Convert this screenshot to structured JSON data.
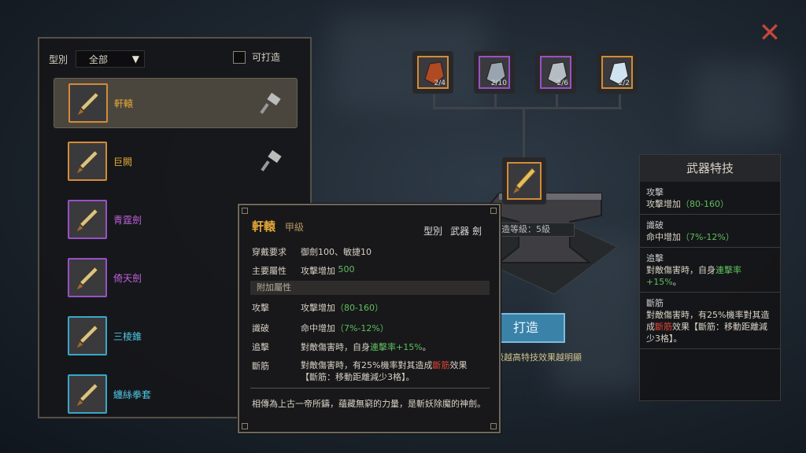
{
  "filter": {
    "label": "型別",
    "value": "全部",
    "checkbox_label": "可打造"
  },
  "items": [
    {
      "name": "軒轅",
      "color": "#e6a838",
      "border": "#d48c36",
      "hammer": true
    },
    {
      "name": "巨闕",
      "color": "#e6a838",
      "border": "#d48c36",
      "hammer": true
    },
    {
      "name": "青霆劍",
      "color": "#c060e0",
      "border": "#9a50c8",
      "hammer": false
    },
    {
      "name": "倚天劍",
      "color": "#c060e0",
      "border": "#9a50c8",
      "hammer": false
    },
    {
      "name": "三棱錐",
      "color": "#4ec7e8",
      "border": "#3aa6c8",
      "hammer": false
    },
    {
      "name": "纏絲拳套",
      "color": "#4ec7e8",
      "border": "#3aa6c8",
      "hammer": false
    }
  ],
  "tooltip": {
    "name": "軒轅",
    "grade": "甲級",
    "type_label": "型別",
    "type_value": "武器 劍",
    "req_label": "穿戴要求",
    "req_value": "御劍100、敏捷10",
    "main_label": "主要屬性",
    "main_value": "攻擊增加",
    "main_num": "500",
    "extra_label": "附加屬性",
    "attrs": [
      {
        "k": "攻擊",
        "pre": "攻擊增加",
        "g": "（80-160）"
      },
      {
        "k": "識破",
        "pre": "命中增加",
        "g": "（7%-12%）"
      },
      {
        "k": "追擊",
        "pre": "對敵傷害時，自身",
        "g": "連擊率+15%",
        "post": "。"
      }
    ],
    "last_k": "斷筋",
    "last_a": "對敵傷害時，有25%機率對其造成",
    "last_r": "斷筋",
    "last_b": "效果",
    "last_c": "【斷筋：移動距離減少3格】。",
    "desc": "相傳為上古一帝所鑄，蘊藏無窮的力量，是斬妖除魔的神劍。"
  },
  "materials": [
    {
      "count": "2/4",
      "border": "#d48c36",
      "color": "#b04a22"
    },
    {
      "count": "2/10",
      "border": "#9a50c8",
      "color": "#9aa4b0"
    },
    {
      "count": "2/6",
      "border": "#9a50c8",
      "color": "#b6bcc4"
    },
    {
      "count": "2/2",
      "border": "#d48c36",
      "color": "#cfe4f0"
    }
  ],
  "level": "造等級：5級",
  "forge_button": "打造",
  "hint": "等級越高特技效果越明顯",
  "skills": {
    "title": "武器特技",
    "list": [
      {
        "t": "攻擊",
        "a": "攻擊增加",
        "g": "（80-160）"
      },
      {
        "t": "識破",
        "a": "命中增加",
        "g": "（7%-12%）"
      },
      {
        "t": "追擊",
        "a": "對敵傷害時，自身",
        "g": "連擊率+15%",
        "b": "。"
      },
      {
        "t": "斷筋",
        "a": "對敵傷害時，有25%機率對其造成",
        "r": "斷筋",
        "b": "效果【斷筋：移動距離減少3格】。"
      }
    ]
  }
}
